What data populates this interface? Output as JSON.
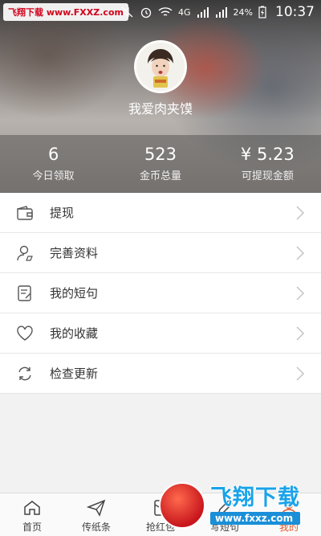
{
  "status_bar": {
    "watermark": "飞翔下载 www.FXXZ.com",
    "network": "4G",
    "battery": "24%",
    "time": "10:37"
  },
  "profile": {
    "username": "我爱肉夹馍"
  },
  "stats": [
    {
      "value": "6",
      "label": "今日领取"
    },
    {
      "value": "523",
      "label": "金币总量"
    },
    {
      "value": "¥ 5.23",
      "label": "可提现金额"
    }
  ],
  "menu": [
    {
      "label": "提现",
      "icon": "wallet-icon"
    },
    {
      "label": "完善资料",
      "icon": "user-edit-icon"
    },
    {
      "label": "我的短句",
      "icon": "note-edit-icon"
    },
    {
      "label": "我的收藏",
      "icon": "heart-icon"
    },
    {
      "label": "检查更新",
      "icon": "refresh-icon"
    }
  ],
  "bottom_nav": [
    {
      "label": "首页",
      "icon": "home-icon"
    },
    {
      "label": "传纸条",
      "icon": "paper-plane-icon"
    },
    {
      "label": "抢红包",
      "icon": "red-packet-icon"
    },
    {
      "label": "写短句",
      "icon": "pen-icon"
    },
    {
      "label": "我的",
      "icon": "user-icon",
      "active": true
    }
  ],
  "watermark_bottom": {
    "title": "飞翔下载",
    "url": "www.fxxz.com"
  },
  "colors": {
    "accent": "#e05a2b",
    "divider": "#e6e6e6"
  }
}
